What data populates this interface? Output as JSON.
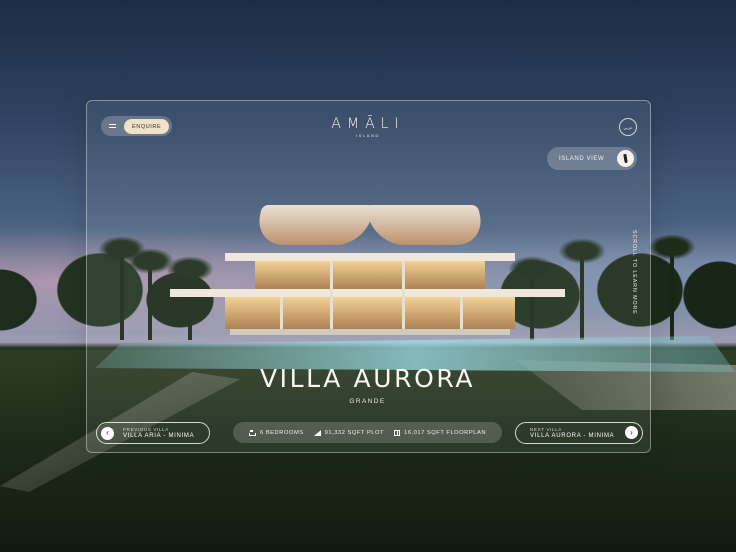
{
  "brand": {
    "name": "AMĀLI",
    "sub": "ISLAND"
  },
  "header": {
    "enquire_label": "ENQUIRE",
    "lang_label": "عربي",
    "island_view_label": "ISLAND VIEW"
  },
  "side": {
    "scroll_hint": "SCROLL TO LEARN MORE"
  },
  "villa": {
    "name": "VILLA AURORA",
    "type": "GRANDE"
  },
  "stats": {
    "bedrooms": "6 BEDROOMS",
    "plot": "91,332 SQFT PLOT",
    "floorplan": "16,017 SQFT FLOORPLAN"
  },
  "nav": {
    "prev_kicker": "PREVIOUS VILLA",
    "prev_title": "VILLA ARIA - MINIMA",
    "next_kicker": "NEXT VILLA",
    "next_title": "VILLA AURORA - MINIMA"
  },
  "colors": {
    "accent_button": "#efe2c9",
    "frame_border": "rgba(255,255,255,0.38)"
  },
  "icons": [
    "menu-icon",
    "island-icon",
    "bed-icon",
    "plot-icon",
    "floorplan-icon",
    "arrow-left-icon",
    "arrow-right-icon"
  ]
}
